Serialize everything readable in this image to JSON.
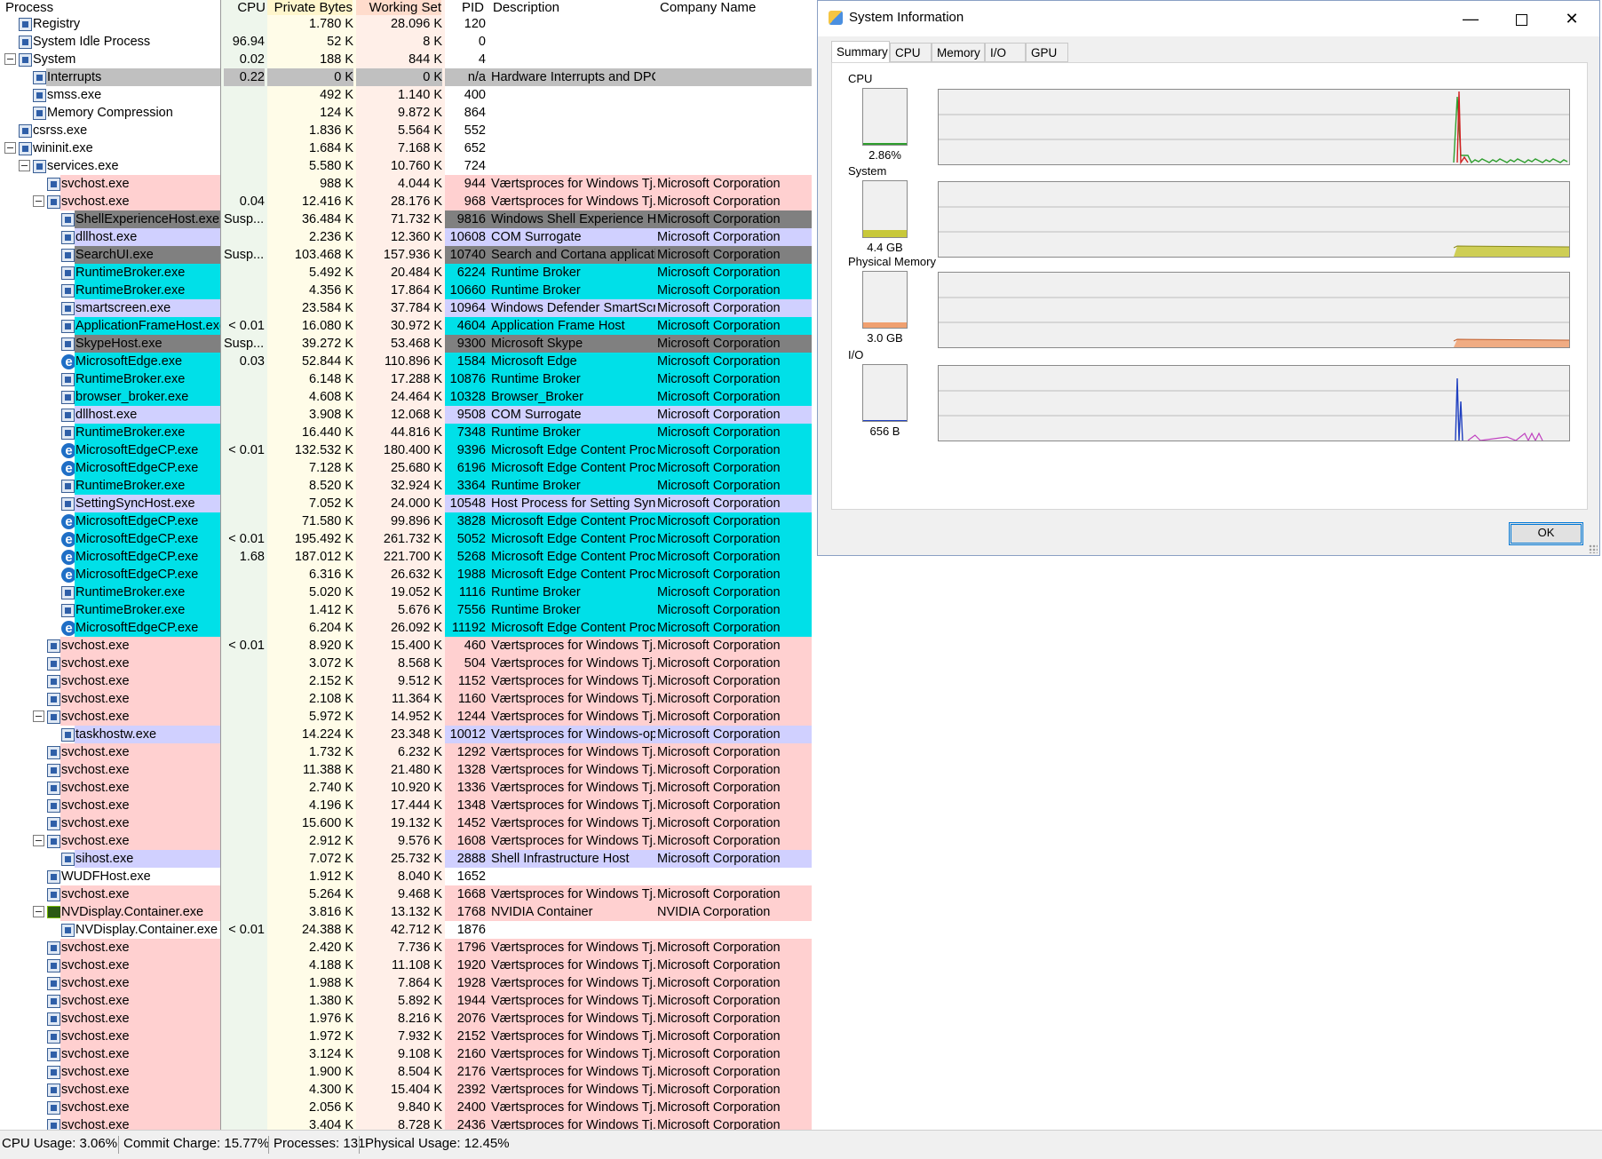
{
  "columns": {
    "process": "Process",
    "cpu": "CPU",
    "private": "Private Bytes",
    "working": "Working Set",
    "pid": "PID",
    "desc": "Description",
    "company": "Company Name"
  },
  "colors": {
    "service": "#ffd0d0",
    "app": "#00e0e8",
    "own": "#d0d0ff",
    "suspended": "#808080",
    "interrupts": "#c0c0c0",
    "private_col": "#fffce8",
    "working_col": "#ffefe8",
    "cpu_col": "#eef6ec"
  },
  "rows": [
    {
      "name": "Registry",
      "level": 0,
      "tog": false,
      "icon": "proc",
      "cpu": "",
      "priv": "1.780 K",
      "ws": "28.096 K",
      "pid": "120",
      "desc": "",
      "co": "",
      "type": "none"
    },
    {
      "name": "System Idle Process",
      "level": 0,
      "tog": false,
      "icon": "proc",
      "cpu": "96.94",
      "priv": "52 K",
      "ws": "8 K",
      "pid": "0",
      "desc": "",
      "co": "",
      "type": "none"
    },
    {
      "name": "System",
      "level": 0,
      "tog": true,
      "icon": "proc",
      "cpu": "0.02",
      "priv": "188 K",
      "ws": "844 K",
      "pid": "4",
      "desc": "",
      "co": "",
      "type": "none"
    },
    {
      "name": "Interrupts",
      "level": 1,
      "tog": false,
      "icon": "proc",
      "cpu": "0.22",
      "priv": "0 K",
      "ws": "0 K",
      "pid": "n/a",
      "desc": "Hardware Interrupts and DPCs",
      "co": "",
      "type": "gray"
    },
    {
      "name": "smss.exe",
      "level": 1,
      "tog": false,
      "icon": "proc",
      "cpu": "",
      "priv": "492 K",
      "ws": "1.140 K",
      "pid": "400",
      "desc": "",
      "co": "",
      "type": "none"
    },
    {
      "name": "Memory Compression",
      "level": 1,
      "tog": false,
      "icon": "proc",
      "cpu": "",
      "priv": "124 K",
      "ws": "9.872 K",
      "pid": "864",
      "desc": "",
      "co": "",
      "type": "none"
    },
    {
      "name": "csrss.exe",
      "level": 0,
      "tog": false,
      "icon": "proc",
      "cpu": "",
      "priv": "1.836 K",
      "ws": "5.564 K",
      "pid": "552",
      "desc": "",
      "co": "",
      "type": "none"
    },
    {
      "name": "wininit.exe",
      "level": 0,
      "tog": true,
      "icon": "proc",
      "cpu": "",
      "priv": "1.684 K",
      "ws": "7.168 K",
      "pid": "652",
      "desc": "",
      "co": "",
      "type": "none"
    },
    {
      "name": "services.exe",
      "level": 1,
      "tog": true,
      "icon": "proc",
      "cpu": "",
      "priv": "5.580 K",
      "ws": "10.760 K",
      "pid": "724",
      "desc": "",
      "co": "",
      "type": "none"
    },
    {
      "name": "svchost.exe",
      "level": 2,
      "tog": false,
      "icon": "proc",
      "cpu": "",
      "priv": "988 K",
      "ws": "4.044 K",
      "pid": "944",
      "desc": "Værtsproces for Windows Tj...",
      "co": "Microsoft Corporation",
      "type": "svc"
    },
    {
      "name": "svchost.exe",
      "level": 2,
      "tog": true,
      "icon": "proc",
      "cpu": "0.04",
      "priv": "12.416 K",
      "ws": "28.176 K",
      "pid": "968",
      "desc": "Værtsproces for Windows Tj...",
      "co": "Microsoft Corporation",
      "type": "svc"
    },
    {
      "name": "ShellExperienceHost.exe",
      "level": 3,
      "tog": false,
      "icon": "proc",
      "cpu": "Susp...",
      "priv": "36.484 K",
      "ws": "71.732 K",
      "pid": "9816",
      "desc": "Windows Shell Experience H...",
      "co": "Microsoft Corporation",
      "type": "susp"
    },
    {
      "name": "dllhost.exe",
      "level": 3,
      "tog": false,
      "icon": "proc",
      "cpu": "",
      "priv": "2.236 K",
      "ws": "12.360 K",
      "pid": "10608",
      "desc": "COM Surrogate",
      "co": "Microsoft Corporation",
      "type": "own"
    },
    {
      "name": "SearchUI.exe",
      "level": 3,
      "tog": false,
      "icon": "proc",
      "cpu": "Susp...",
      "priv": "103.468 K",
      "ws": "157.936 K",
      "pid": "10740",
      "desc": "Search and Cortana applicati...",
      "co": "Microsoft Corporation",
      "type": "susp"
    },
    {
      "name": "RuntimeBroker.exe",
      "level": 3,
      "tog": false,
      "icon": "proc",
      "cpu": "",
      "priv": "5.492 K",
      "ws": "20.484 K",
      "pid": "6224",
      "desc": "Runtime Broker",
      "co": "Microsoft Corporation",
      "type": "app"
    },
    {
      "name": "RuntimeBroker.exe",
      "level": 3,
      "tog": false,
      "icon": "proc",
      "cpu": "",
      "priv": "4.356 K",
      "ws": "17.864 K",
      "pid": "10660",
      "desc": "Runtime Broker",
      "co": "Microsoft Corporation",
      "type": "app"
    },
    {
      "name": "smartscreen.exe",
      "level": 3,
      "tog": false,
      "icon": "proc",
      "cpu": "",
      "priv": "23.584 K",
      "ws": "37.784 K",
      "pid": "10964",
      "desc": "Windows Defender SmartScr...",
      "co": "Microsoft Corporation",
      "type": "own"
    },
    {
      "name": "ApplicationFrameHost.exe",
      "level": 3,
      "tog": false,
      "icon": "proc",
      "cpu": "< 0.01",
      "priv": "16.080 K",
      "ws": "30.972 K",
      "pid": "4604",
      "desc": "Application Frame Host",
      "co": "Microsoft Corporation",
      "type": "app"
    },
    {
      "name": "SkypeHost.exe",
      "level": 3,
      "tog": false,
      "icon": "proc",
      "cpu": "Susp...",
      "priv": "39.272 K",
      "ws": "53.468 K",
      "pid": "9300",
      "desc": "Microsoft Skype",
      "co": "Microsoft Corporation",
      "type": "susp"
    },
    {
      "name": "MicrosoftEdge.exe",
      "level": 3,
      "tog": false,
      "icon": "edge",
      "cpu": "0.03",
      "priv": "52.844 K",
      "ws": "110.896 K",
      "pid": "1584",
      "desc": "Microsoft Edge",
      "co": "Microsoft Corporation",
      "type": "app"
    },
    {
      "name": "RuntimeBroker.exe",
      "level": 3,
      "tog": false,
      "icon": "proc",
      "cpu": "",
      "priv": "6.148 K",
      "ws": "17.288 K",
      "pid": "10876",
      "desc": "Runtime Broker",
      "co": "Microsoft Corporation",
      "type": "app"
    },
    {
      "name": "browser_broker.exe",
      "level": 3,
      "tog": false,
      "icon": "proc",
      "cpu": "",
      "priv": "4.608 K",
      "ws": "24.464 K",
      "pid": "10328",
      "desc": "Browser_Broker",
      "co": "Microsoft Corporation",
      "type": "app"
    },
    {
      "name": "dllhost.exe",
      "level": 3,
      "tog": false,
      "icon": "proc",
      "cpu": "",
      "priv": "3.908 K",
      "ws": "12.068 K",
      "pid": "9508",
      "desc": "COM Surrogate",
      "co": "Microsoft Corporation",
      "type": "own"
    },
    {
      "name": "RuntimeBroker.exe",
      "level": 3,
      "tog": false,
      "icon": "proc",
      "cpu": "",
      "priv": "16.440 K",
      "ws": "44.816 K",
      "pid": "7348",
      "desc": "Runtime Broker",
      "co": "Microsoft Corporation",
      "type": "app"
    },
    {
      "name": "MicrosoftEdgeCP.exe",
      "level": 3,
      "tog": false,
      "icon": "edge",
      "cpu": "< 0.01",
      "priv": "132.532 K",
      "ws": "180.400 K",
      "pid": "9396",
      "desc": "Microsoft Edge Content Proc...",
      "co": "Microsoft Corporation",
      "type": "app"
    },
    {
      "name": "MicrosoftEdgeCP.exe",
      "level": 3,
      "tog": false,
      "icon": "edge",
      "cpu": "",
      "priv": "7.128 K",
      "ws": "25.680 K",
      "pid": "6196",
      "desc": "Microsoft Edge Content Proc...",
      "co": "Microsoft Corporation",
      "type": "app"
    },
    {
      "name": "RuntimeBroker.exe",
      "level": 3,
      "tog": false,
      "icon": "proc",
      "cpu": "",
      "priv": "8.520 K",
      "ws": "32.924 K",
      "pid": "3364",
      "desc": "Runtime Broker",
      "co": "Microsoft Corporation",
      "type": "app"
    },
    {
      "name": "SettingSyncHost.exe",
      "level": 3,
      "tog": false,
      "icon": "proc",
      "cpu": "",
      "priv": "7.052 K",
      "ws": "24.000 K",
      "pid": "10548",
      "desc": "Host Process for Setting Syn...",
      "co": "Microsoft Corporation",
      "type": "own"
    },
    {
      "name": "MicrosoftEdgeCP.exe",
      "level": 3,
      "tog": false,
      "icon": "edge",
      "cpu": "",
      "priv": "71.580 K",
      "ws": "99.896 K",
      "pid": "3828",
      "desc": "Microsoft Edge Content Proc...",
      "co": "Microsoft Corporation",
      "type": "app"
    },
    {
      "name": "MicrosoftEdgeCP.exe",
      "level": 3,
      "tog": false,
      "icon": "edge",
      "cpu": "< 0.01",
      "priv": "195.492 K",
      "ws": "261.732 K",
      "pid": "5052",
      "desc": "Microsoft Edge Content Proc...",
      "co": "Microsoft Corporation",
      "type": "app"
    },
    {
      "name": "MicrosoftEdgeCP.exe",
      "level": 3,
      "tog": false,
      "icon": "edge",
      "cpu": "1.68",
      "priv": "187.012 K",
      "ws": "221.700 K",
      "pid": "5268",
      "desc": "Microsoft Edge Content Proc...",
      "co": "Microsoft Corporation",
      "type": "app"
    },
    {
      "name": "MicrosoftEdgeCP.exe",
      "level": 3,
      "tog": false,
      "icon": "edge",
      "cpu": "",
      "priv": "6.316 K",
      "ws": "26.632 K",
      "pid": "1988",
      "desc": "Microsoft Edge Content Proc...",
      "co": "Microsoft Corporation",
      "type": "app"
    },
    {
      "name": "RuntimeBroker.exe",
      "level": 3,
      "tog": false,
      "icon": "proc",
      "cpu": "",
      "priv": "5.020 K",
      "ws": "19.052 K",
      "pid": "1116",
      "desc": "Runtime Broker",
      "co": "Microsoft Corporation",
      "type": "app"
    },
    {
      "name": "RuntimeBroker.exe",
      "level": 3,
      "tog": false,
      "icon": "proc",
      "cpu": "",
      "priv": "1.412 K",
      "ws": "5.676 K",
      "pid": "7556",
      "desc": "Runtime Broker",
      "co": "Microsoft Corporation",
      "type": "app"
    },
    {
      "name": "MicrosoftEdgeCP.exe",
      "level": 3,
      "tog": false,
      "icon": "edge",
      "cpu": "",
      "priv": "6.204 K",
      "ws": "26.092 K",
      "pid": "11192",
      "desc": "Microsoft Edge Content Proc...",
      "co": "Microsoft Corporation",
      "type": "app"
    },
    {
      "name": "svchost.exe",
      "level": 2,
      "tog": false,
      "icon": "proc",
      "cpu": "< 0.01",
      "priv": "8.920 K",
      "ws": "15.400 K",
      "pid": "460",
      "desc": "Værtsproces for Windows Tj...",
      "co": "Microsoft Corporation",
      "type": "svc"
    },
    {
      "name": "svchost.exe",
      "level": 2,
      "tog": false,
      "icon": "proc",
      "cpu": "",
      "priv": "3.072 K",
      "ws": "8.568 K",
      "pid": "504",
      "desc": "Værtsproces for Windows Tj...",
      "co": "Microsoft Corporation",
      "type": "svc"
    },
    {
      "name": "svchost.exe",
      "level": 2,
      "tog": false,
      "icon": "proc",
      "cpu": "",
      "priv": "2.152 K",
      "ws": "9.512 K",
      "pid": "1152",
      "desc": "Værtsproces for Windows Tj...",
      "co": "Microsoft Corporation",
      "type": "svc"
    },
    {
      "name": "svchost.exe",
      "level": 2,
      "tog": false,
      "icon": "proc",
      "cpu": "",
      "priv": "2.108 K",
      "ws": "11.364 K",
      "pid": "1160",
      "desc": "Værtsproces for Windows Tj...",
      "co": "Microsoft Corporation",
      "type": "svc"
    },
    {
      "name": "svchost.exe",
      "level": 2,
      "tog": true,
      "icon": "proc",
      "cpu": "",
      "priv": "5.972 K",
      "ws": "14.952 K",
      "pid": "1244",
      "desc": "Værtsproces for Windows Tj...",
      "co": "Microsoft Corporation",
      "type": "svc"
    },
    {
      "name": "taskhostw.exe",
      "level": 3,
      "tog": false,
      "icon": "proc",
      "cpu": "",
      "priv": "14.224 K",
      "ws": "23.348 K",
      "pid": "10012",
      "desc": "Værtsproces for Windows-op...",
      "co": "Microsoft Corporation",
      "type": "own"
    },
    {
      "name": "svchost.exe",
      "level": 2,
      "tog": false,
      "icon": "proc",
      "cpu": "",
      "priv": "1.732 K",
      "ws": "6.232 K",
      "pid": "1292",
      "desc": "Værtsproces for Windows Tj...",
      "co": "Microsoft Corporation",
      "type": "svc"
    },
    {
      "name": "svchost.exe",
      "level": 2,
      "tog": false,
      "icon": "proc",
      "cpu": "",
      "priv": "11.388 K",
      "ws": "21.480 K",
      "pid": "1328",
      "desc": "Værtsproces for Windows Tj...",
      "co": "Microsoft Corporation",
      "type": "svc"
    },
    {
      "name": "svchost.exe",
      "level": 2,
      "tog": false,
      "icon": "proc",
      "cpu": "",
      "priv": "2.740 K",
      "ws": "10.920 K",
      "pid": "1336",
      "desc": "Værtsproces for Windows Tj...",
      "co": "Microsoft Corporation",
      "type": "svc"
    },
    {
      "name": "svchost.exe",
      "level": 2,
      "tog": false,
      "icon": "proc",
      "cpu": "",
      "priv": "4.196 K",
      "ws": "17.444 K",
      "pid": "1348",
      "desc": "Værtsproces for Windows Tj...",
      "co": "Microsoft Corporation",
      "type": "svc"
    },
    {
      "name": "svchost.exe",
      "level": 2,
      "tog": false,
      "icon": "proc",
      "cpu": "",
      "priv": "15.600 K",
      "ws": "19.132 K",
      "pid": "1452",
      "desc": "Værtsproces for Windows Tj...",
      "co": "Microsoft Corporation",
      "type": "svc"
    },
    {
      "name": "svchost.exe",
      "level": 2,
      "tog": true,
      "icon": "proc",
      "cpu": "",
      "priv": "2.912 K",
      "ws": "9.576 K",
      "pid": "1608",
      "desc": "Værtsproces for Windows Tj...",
      "co": "Microsoft Corporation",
      "type": "svc"
    },
    {
      "name": "sihost.exe",
      "level": 3,
      "tog": false,
      "icon": "proc",
      "cpu": "",
      "priv": "7.072 K",
      "ws": "25.732 K",
      "pid": "2888",
      "desc": "Shell Infrastructure Host",
      "co": "Microsoft Corporation",
      "type": "own"
    },
    {
      "name": "WUDFHost.exe",
      "level": 2,
      "tog": false,
      "icon": "proc",
      "cpu": "",
      "priv": "1.912 K",
      "ws": "8.040 K",
      "pid": "1652",
      "desc": "",
      "co": "",
      "type": "none"
    },
    {
      "name": "svchost.exe",
      "level": 2,
      "tog": false,
      "icon": "proc",
      "cpu": "",
      "priv": "5.264 K",
      "ws": "9.468 K",
      "pid": "1668",
      "desc": "Værtsproces for Windows Tj...",
      "co": "Microsoft Corporation",
      "type": "svc"
    },
    {
      "name": "NVDisplay.Container.exe",
      "level": 2,
      "tog": true,
      "icon": "nv",
      "cpu": "",
      "priv": "3.816 K",
      "ws": "13.132 K",
      "pid": "1768",
      "desc": "NVIDIA Container",
      "co": "NVIDIA Corporation",
      "type": "svc"
    },
    {
      "name": "NVDisplay.Container.exe",
      "level": 3,
      "tog": false,
      "icon": "proc",
      "cpu": "< 0.01",
      "priv": "24.388 K",
      "ws": "42.712 K",
      "pid": "1876",
      "desc": "",
      "co": "",
      "type": "none"
    },
    {
      "name": "svchost.exe",
      "level": 2,
      "tog": false,
      "icon": "proc",
      "cpu": "",
      "priv": "2.420 K",
      "ws": "7.736 K",
      "pid": "1796",
      "desc": "Værtsproces for Windows Tj...",
      "co": "Microsoft Corporation",
      "type": "svc"
    },
    {
      "name": "svchost.exe",
      "level": 2,
      "tog": false,
      "icon": "proc",
      "cpu": "",
      "priv": "4.188 K",
      "ws": "11.108 K",
      "pid": "1920",
      "desc": "Værtsproces for Windows Tj...",
      "co": "Microsoft Corporation",
      "type": "svc"
    },
    {
      "name": "svchost.exe",
      "level": 2,
      "tog": false,
      "icon": "proc",
      "cpu": "",
      "priv": "1.988 K",
      "ws": "7.864 K",
      "pid": "1928",
      "desc": "Værtsproces for Windows Tj...",
      "co": "Microsoft Corporation",
      "type": "svc"
    },
    {
      "name": "svchost.exe",
      "level": 2,
      "tog": false,
      "icon": "proc",
      "cpu": "",
      "priv": "1.380 K",
      "ws": "5.892 K",
      "pid": "1944",
      "desc": "Værtsproces for Windows Tj...",
      "co": "Microsoft Corporation",
      "type": "svc"
    },
    {
      "name": "svchost.exe",
      "level": 2,
      "tog": false,
      "icon": "proc",
      "cpu": "",
      "priv": "1.976 K",
      "ws": "8.216 K",
      "pid": "2076",
      "desc": "Værtsproces for Windows Tj...",
      "co": "Microsoft Corporation",
      "type": "svc"
    },
    {
      "name": "svchost.exe",
      "level": 2,
      "tog": false,
      "icon": "proc",
      "cpu": "",
      "priv": "1.972 K",
      "ws": "7.932 K",
      "pid": "2152",
      "desc": "Værtsproces for Windows Tj...",
      "co": "Microsoft Corporation",
      "type": "svc"
    },
    {
      "name": "svchost.exe",
      "level": 2,
      "tog": false,
      "icon": "proc",
      "cpu": "",
      "priv": "3.124 K",
      "ws": "9.108 K",
      "pid": "2160",
      "desc": "Værtsproces for Windows Tj...",
      "co": "Microsoft Corporation",
      "type": "svc"
    },
    {
      "name": "svchost.exe",
      "level": 2,
      "tog": false,
      "icon": "proc",
      "cpu": "",
      "priv": "1.900 K",
      "ws": "8.504 K",
      "pid": "2176",
      "desc": "Værtsproces for Windows Tj...",
      "co": "Microsoft Corporation",
      "type": "svc"
    },
    {
      "name": "svchost.exe",
      "level": 2,
      "tog": false,
      "icon": "proc",
      "cpu": "",
      "priv": "4.300 K",
      "ws": "15.404 K",
      "pid": "2392",
      "desc": "Værtsproces for Windows Tj...",
      "co": "Microsoft Corporation",
      "type": "svc"
    },
    {
      "name": "svchost.exe",
      "level": 2,
      "tog": false,
      "icon": "proc",
      "cpu": "",
      "priv": "2.056 K",
      "ws": "9.840 K",
      "pid": "2400",
      "desc": "Værtsproces for Windows Tj...",
      "co": "Microsoft Corporation",
      "type": "svc"
    },
    {
      "name": "svchost.exe",
      "level": 2,
      "tog": false,
      "icon": "proc",
      "cpu": "",
      "priv": "3.404 K",
      "ws": "8.728 K",
      "pid": "2436",
      "desc": "Værtsproces for Windows Tj...",
      "co": "Microsoft Corporation",
      "type": "svc"
    }
  ],
  "status": {
    "cpu": "CPU Usage: 3.06%",
    "commit": "Commit Charge: 15.77%",
    "processes": "Processes: 131",
    "physical": "Physical Usage: 12.45%"
  },
  "sysinfo": {
    "title": "System Information",
    "window_icon": "system-info-icon",
    "tabs": [
      "Summary",
      "CPU",
      "Memory",
      "I/O",
      "GPU"
    ],
    "active_tab": "Summary",
    "ok_label": "OK",
    "graphs": [
      {
        "label": "CPU",
        "value": "2.86%",
        "fill": 0.03,
        "color": "#2e9e2e",
        "color2": "#d02020"
      },
      {
        "label": "System",
        "value": "4.4 GB",
        "fill": 0.12,
        "color": "#c8c83a"
      },
      {
        "label": "Physical Memory",
        "value": "3.0 GB",
        "fill": 0.1,
        "color": "#f0a070"
      },
      {
        "label": "I/O",
        "value": "656 B",
        "fill": 0.0,
        "color": "#2040c0",
        "color2": "#c040c0"
      }
    ]
  }
}
